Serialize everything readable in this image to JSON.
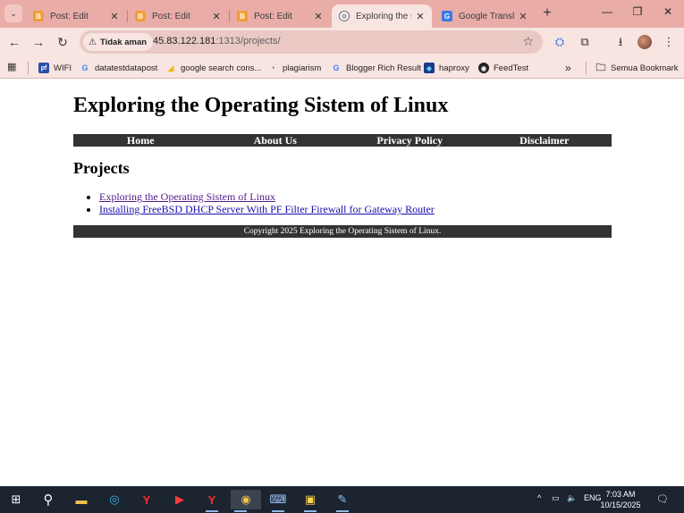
{
  "tabs": [
    {
      "title": "Post: Edit",
      "favicon": "blogger-icon",
      "active": false
    },
    {
      "title": "Post: Edit",
      "favicon": "blogger-icon",
      "active": false
    },
    {
      "title": "Post: Edit",
      "favicon": "blogger-icon",
      "active": false
    },
    {
      "title": "Exploring the O",
      "favicon": "globe-icon",
      "active": true
    },
    {
      "title": "Google Translat",
      "favicon": "google-translate-icon",
      "active": false
    }
  ],
  "toolbar": {
    "security_label": "Tidak aman",
    "url_host": "45.83.122.181",
    "url_rest": ":1313/projects/"
  },
  "bookmarks": {
    "items": [
      {
        "label": "WIFI",
        "icon": "wifi-bookmark-icon"
      },
      {
        "label": "datatestdatapost",
        "icon": "google-icon"
      },
      {
        "label": "google search cons...",
        "icon": "search-console-icon"
      },
      {
        "label": "plagiarism",
        "icon": "plagiarism-icon"
      },
      {
        "label": "Blogger Rich Result",
        "icon": "google-icon"
      },
      {
        "label": "haproxy",
        "icon": "haproxy-icon"
      },
      {
        "label": "FeedTest",
        "icon": "feedtest-icon"
      }
    ],
    "overflow_label": "»",
    "all_bookmarks_label": "Semua Bookmark"
  },
  "page": {
    "site_title": "Exploring the Operating Sistem of Linux",
    "nav": [
      "Home",
      "About Us",
      "Privacy Policy",
      "Disclaimer"
    ],
    "section_title": "Projects",
    "projects": [
      "Exploring the Operating Sistem of Linux",
      "Installing FreeBSD DHCP Server With PF Filter Firewall for Gateway Router"
    ],
    "footer": "Copyright 2025 Exploring the Operating Sistem of Linux."
  },
  "taskbar": {
    "language": "ENG",
    "time": "7:03 AM",
    "date": "10/15/2025"
  },
  "colors": {
    "tabstrip": "#e9aca6",
    "toolbar": "#f8e4e1",
    "nav_bar": "#333333",
    "link": "#1a0dab",
    "visited_link": "#551a8b"
  }
}
